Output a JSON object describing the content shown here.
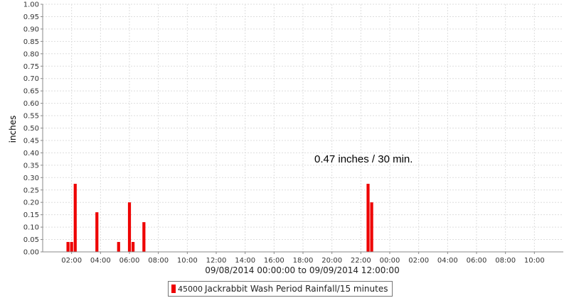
{
  "chart_data": {
    "type": "bar",
    "ylabel": "inches",
    "ylim": [
      0,
      1
    ],
    "y_ticks": [
      "0.00",
      "0.05",
      "0.10",
      "0.15",
      "0.20",
      "0.25",
      "0.30",
      "0.35",
      "0.40",
      "0.45",
      "0.50",
      "0.55",
      "0.60",
      "0.65",
      "0.70",
      "0.75",
      "0.80",
      "0.85",
      "0.90",
      "0.95",
      "1.00"
    ],
    "x_range_label": "09/08/2014 00:00:00 to 09/09/2014 12:00:00",
    "x_range_hours": [
      0,
      36
    ],
    "x_ticks": [
      {
        "hour": 2,
        "label": "02:00"
      },
      {
        "hour": 4,
        "label": "04:00"
      },
      {
        "hour": 6,
        "label": "06:00"
      },
      {
        "hour": 8,
        "label": "08:00"
      },
      {
        "hour": 10,
        "label": "10:00"
      },
      {
        "hour": 12,
        "label": "12:00"
      },
      {
        "hour": 14,
        "label": "14:00"
      },
      {
        "hour": 16,
        "label": "16:00"
      },
      {
        "hour": 18,
        "label": "18:00"
      },
      {
        "hour": 20,
        "label": "20:00"
      },
      {
        "hour": 22,
        "label": "22:00"
      },
      {
        "hour": 24,
        "label": "00:00"
      },
      {
        "hour": 26,
        "label": "02:00"
      },
      {
        "hour": 28,
        "label": "04:00"
      },
      {
        "hour": 30,
        "label": "06:00"
      },
      {
        "hour": 32,
        "label": "08:00"
      },
      {
        "hour": 34,
        "label": "10:00"
      }
    ],
    "grid": true,
    "series": [
      {
        "name": "Jackrabbit Wash Period Rainfall/15 minutes",
        "station": "45000",
        "color": "#ee0000",
        "points": [
          {
            "hour": 1.75,
            "value": 0.04
          },
          {
            "hour": 2.0,
            "value": 0.04
          },
          {
            "hour": 2.25,
            "value": 0.275
          },
          {
            "hour": 3.75,
            "value": 0.16
          },
          {
            "hour": 5.25,
            "value": 0.04
          },
          {
            "hour": 6.0,
            "value": 0.2
          },
          {
            "hour": 6.25,
            "value": 0.04
          },
          {
            "hour": 7.0,
            "value": 0.12
          },
          {
            "hour": 22.5,
            "value": 0.275
          },
          {
            "hour": 22.75,
            "value": 0.2
          }
        ]
      }
    ],
    "annotation": "0.47 inches / 30 min.",
    "legend_position": "bottom-center"
  }
}
